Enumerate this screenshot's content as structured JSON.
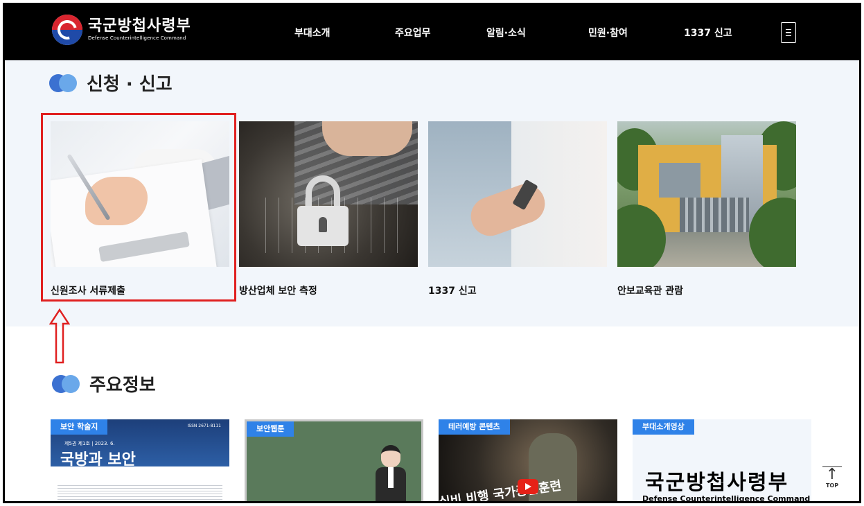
{
  "header": {
    "logo_ko": "국군방첩사령부",
    "logo_en": "Defense Counterintelligence Command",
    "nav": [
      "부대소개",
      "주요업무",
      "알림·소식",
      "민원·참여",
      "1337 신고"
    ],
    "menu_icon": "hamburger-icon"
  },
  "apply": {
    "title": "신청 · 신고",
    "cards": [
      {
        "label": "신원조사 서류제출"
      },
      {
        "label": "방산업체 보안 측정"
      },
      {
        "label": "1337 신고"
      },
      {
        "label": "안보교육관 관람"
      }
    ]
  },
  "info": {
    "title": "주요정보",
    "cards": [
      {
        "tag": "보안 학술지",
        "heading": "국방과 보안",
        "issue": "제5권 제1호 | 2023. 6.",
        "issn": "ISSN 2671-8111"
      },
      {
        "tag": "보안웹툰"
      },
      {
        "tag": "테러예방 콘텐츠",
        "banner": "실비 비행 국가중합훈련"
      },
      {
        "tag": "부대소개영상",
        "heading_ko": "국군방첩사령부",
        "heading_en": "Defense Counterintelligence Command"
      }
    ]
  },
  "top_button": {
    "label": "TOP"
  },
  "colors": {
    "header_bg": "#000000",
    "section_bg": "#f2f6fb",
    "tag_blue": "#2f82e8",
    "highlight_red": "#e02020"
  }
}
